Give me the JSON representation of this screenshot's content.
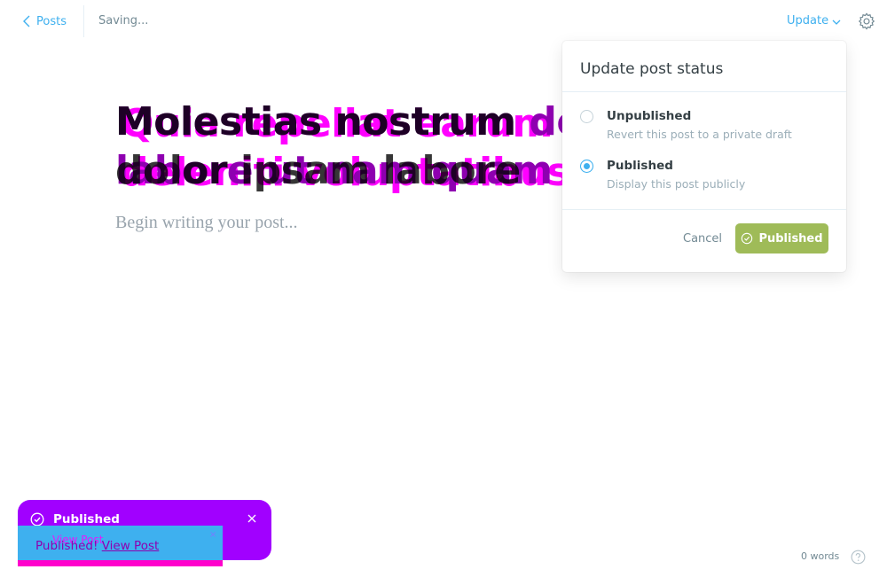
{
  "header": {
    "back_label": "Posts",
    "status": "Saving...",
    "update_label": "Update"
  },
  "editor": {
    "title_main": "Molestias nostrum dolor et ipsam labore ut nam quam",
    "title_ghost": "Quia repellat earum molestias deleniti voluptatibus voluptatem",
    "title_shadow": "Molestias nostrum dolor ipsam labore",
    "body_placeholder": "Begin writing your post..."
  },
  "popover": {
    "title": "Update post status",
    "options": [
      {
        "label": "Unpublished",
        "description": "Revert this post to a private draft",
        "selected": false
      },
      {
        "label": "Published",
        "description": "Display this post publicly",
        "selected": true
      }
    ],
    "cancel_label": "Cancel",
    "publish_label": "Published"
  },
  "notification": {
    "title": "Published",
    "text": "Published!",
    "link": "View Post",
    "ghost_link": "View Post",
    "ghost_close": "×"
  },
  "footer": {
    "word_count": "0 words"
  },
  "colors": {
    "accent": "#3eb0ef",
    "publish_green": "#9fbb58",
    "notification_purple": "#a100ff",
    "title_magenta": "#ff00ff",
    "title_purple": "#8e00b0"
  },
  "icons": {
    "back": "chevron-left-icon",
    "update": "chevron-down-icon",
    "settings": "gear-icon",
    "publish": "check-circle-icon",
    "notification": "check-circle-icon",
    "close": "close-icon",
    "help": "question-circle-icon"
  }
}
